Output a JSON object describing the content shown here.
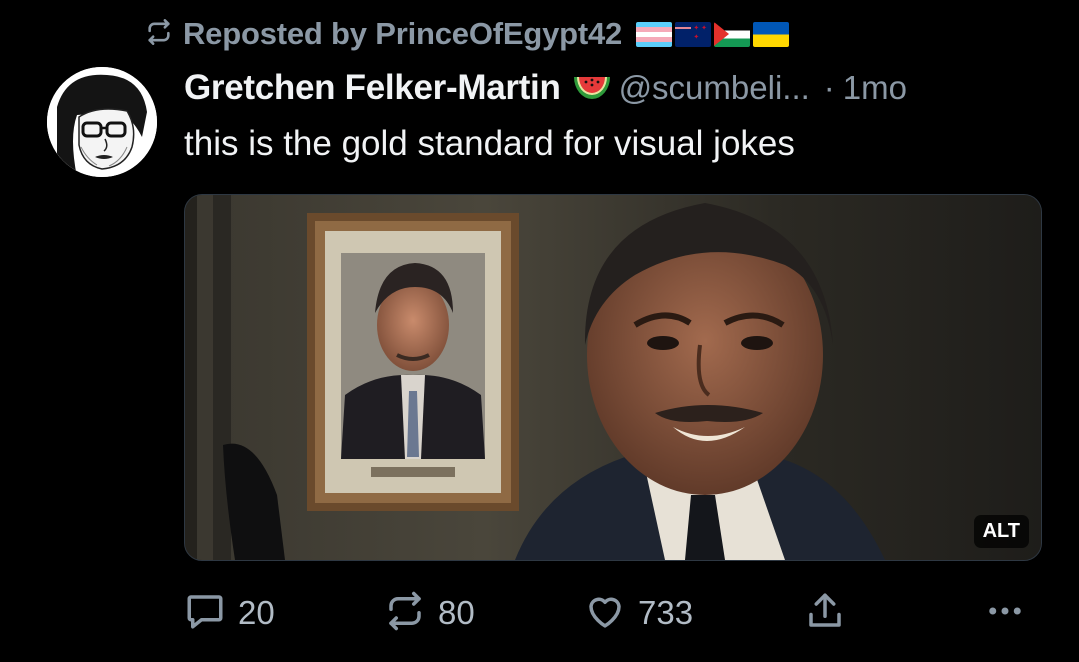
{
  "repost": {
    "label": "Reposted by PrinceOfEgypt42",
    "icon": "repost-icon",
    "flags": [
      "transgender-flag",
      "new-zealand-flag",
      "palestine-flag",
      "ukraine-flag"
    ]
  },
  "post": {
    "author_name": "Gretchen Felker-Martin",
    "author_emoji": "watermelon-icon",
    "handle": "@scumbeli...",
    "separator": "·",
    "time": "1mo",
    "text": "this is the gold standard for visual jokes",
    "media": {
      "alt_badge": "ALT"
    }
  },
  "actions": {
    "reply": {
      "icon": "comment-icon",
      "count": "20"
    },
    "repost": {
      "icon": "repost-icon",
      "count": "80"
    },
    "like": {
      "icon": "heart-icon",
      "count": "733"
    },
    "share": {
      "icon": "share-icon"
    },
    "more": {
      "icon": "more-icon"
    }
  },
  "colors": {
    "background": "#000000",
    "text": "#f1f3f5",
    "muted": "#8b98a5"
  }
}
